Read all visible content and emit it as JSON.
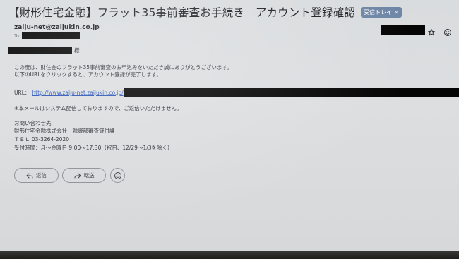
{
  "email": {
    "subject": "【財形住宅金融】フラット35事前審査お手続き　アカウント登録確認",
    "label": "受信トレイ",
    "label_close": "×",
    "sender": "zaiju-net@zaijukin.co.jp",
    "to_label": "To",
    "salutation_suffix": "様",
    "lines": {
      "thanks": "この度は、財住金のフラット35事前審査のお申込みをいただき誠にありがとうございます。",
      "instruction": "以下のURLをクリックすると、アカウント登録が完了します。",
      "url_label": "URL：",
      "url": "http://www.zaiju-net.zaijukin.co.jp/",
      "notice": "※本メールはシステム配信しておりますので、ご返信いただけません。",
      "contact_heading": "お問い合わせ先",
      "company": "財形住宅金融株式会社　融資部審査貸付課",
      "tel": "ＴＥＬ 03-3264-2020",
      "hours": "受付時間：月〜金曜日 9:00〜17:30（祝日、12/29〜1/3を除く）"
    }
  },
  "actions": {
    "reply_label": "返信",
    "forward_label": "転送"
  },
  "icons": {
    "star": "star-icon",
    "emoji": "emoji-icon",
    "reply": "reply-arrow-icon",
    "forward": "forward-arrow-icon"
  },
  "colors": {
    "link": "#2a55b8",
    "label_chip": "#6f86a6",
    "background": "#d9dcde"
  }
}
